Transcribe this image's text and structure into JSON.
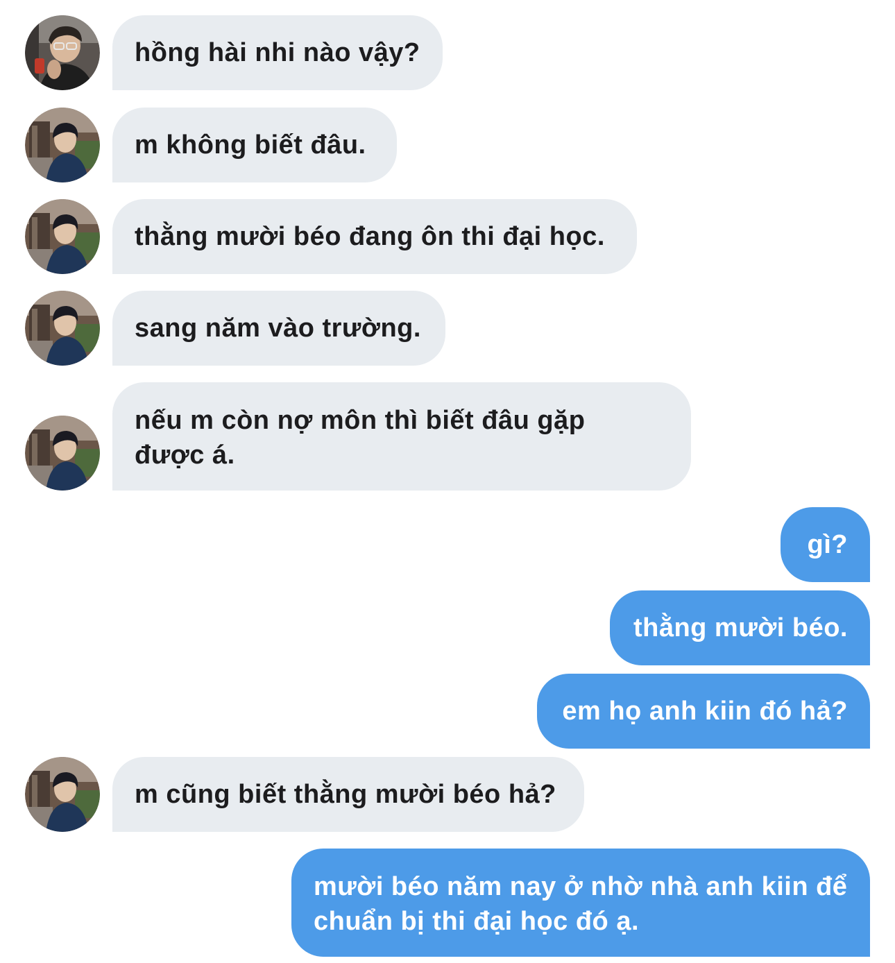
{
  "conversation": {
    "messages": [
      {
        "side": "in",
        "avatar": "avatar-a",
        "text": "hồng hài nhi nào vậy?"
      },
      {
        "side": "in",
        "avatar": "avatar-b",
        "text": "m không biết đâu."
      },
      {
        "side": "in",
        "avatar": "avatar-b",
        "text": "thằng mười béo đang ôn thi đại học."
      },
      {
        "side": "in",
        "avatar": "avatar-b",
        "text": "sang năm vào trường."
      },
      {
        "side": "in",
        "avatar": "avatar-b",
        "text": "nếu m còn nợ môn thì biết đâu gặp được á."
      },
      {
        "side": "out",
        "text": "gì?"
      },
      {
        "side": "out",
        "text": "thằng mười béo."
      },
      {
        "side": "out",
        "text": "em họ anh kiin đó hả?"
      },
      {
        "side": "in",
        "avatar": "avatar-b",
        "text": "m cũng biết thằng mười béo hả?"
      },
      {
        "side": "out",
        "text": "mười béo năm nay ở nhờ nhà anh kiin để chuẩn bị thi đại học đó ạ."
      }
    ]
  },
  "colors": {
    "incoming_bubble": "#e8ecf0",
    "incoming_text": "#1c1c1e",
    "outgoing_bubble": "#4d9be8",
    "outgoing_text": "#ffffff",
    "background": "#ffffff"
  }
}
